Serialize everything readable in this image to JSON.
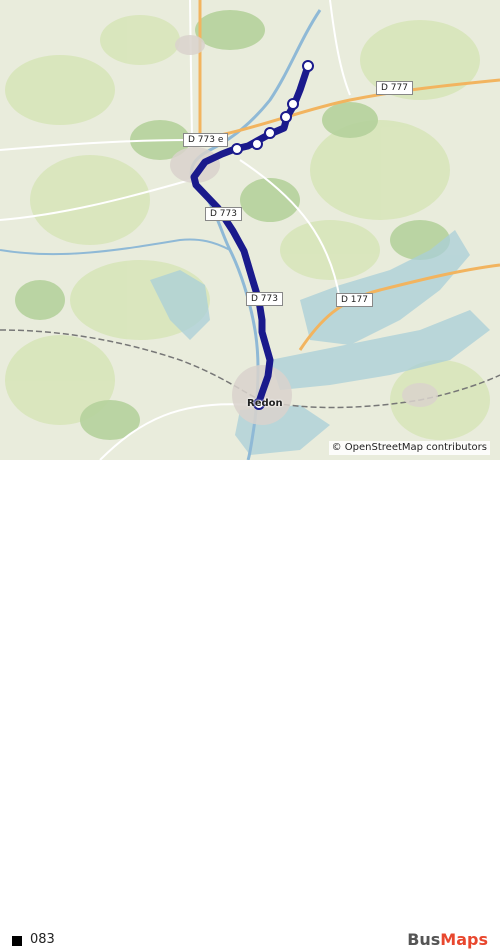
{
  "map": {
    "road_labels": {
      "d777": "D 777",
      "d773e": "D 773 e",
      "d773_mid": "D 773",
      "d773_low": "D 773",
      "d177": "D 177"
    },
    "place_labels": {
      "town": "Redon"
    },
    "route_color": "#1a1a8c",
    "attribution": "© OpenStreetMap contributors"
  },
  "legend": {
    "route_name": "083",
    "swatch_color": "#000000"
  },
  "brand": {
    "part1": "Bus",
    "part2": "Maps"
  }
}
